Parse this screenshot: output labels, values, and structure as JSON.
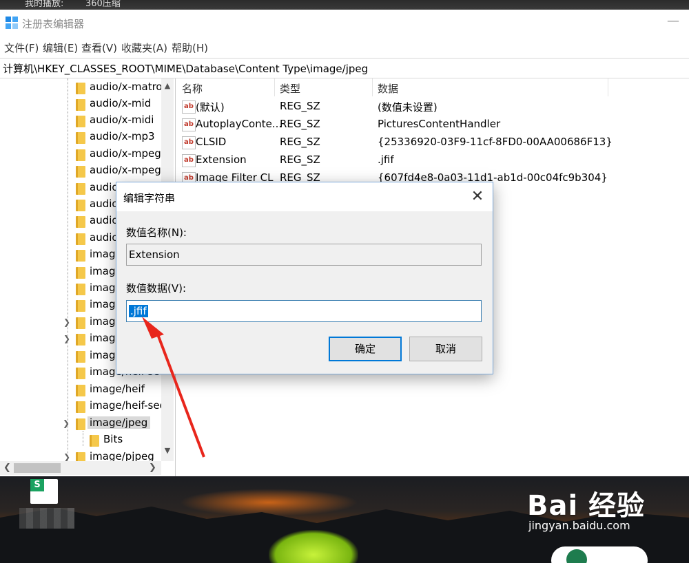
{
  "top_strip": {
    "text1": "我的播放:",
    "text2": "360压缩"
  },
  "window": {
    "title": "注册表编辑器",
    "minimize": "—"
  },
  "menu": [
    "文件(F)",
    "编辑(E)",
    "查看(V)",
    "收藏夹(A)",
    "帮助(H)"
  ],
  "address": "计算机\\HKEY_CLASSES_ROOT\\MIME\\Database\\Content Type\\image/jpeg",
  "tree": {
    "items": [
      "audio/x-matros",
      "audio/x-mid",
      "audio/x-midi",
      "audio/x-mp3",
      "audio/x-mpeg",
      "audio/x-mpegu",
      "audio",
      "audio",
      "audio",
      "audio",
      "image",
      "image",
      "image",
      "image",
      "image",
      "image",
      "image",
      "image/heif-seq",
      "image/heif",
      "image/heif-seq",
      "image/jpeg",
      "Bits",
      "image/pjpeg"
    ]
  },
  "list": {
    "headers": {
      "name": "名称",
      "type": "类型",
      "data": "数据"
    },
    "rows": [
      {
        "name": "(默认)",
        "type": "REG_SZ",
        "data": "(数值未设置)"
      },
      {
        "name": "AutoplayConte...",
        "type": "REG_SZ",
        "data": "PicturesContentHandler"
      },
      {
        "name": "CLSID",
        "type": "REG_SZ",
        "data": "{25336920-03F9-11cf-8FD0-00AA00686F13}"
      },
      {
        "name": "Extension",
        "type": "REG_SZ",
        "data": ".jfif"
      },
      {
        "name": "Image Filter CL",
        "type": "REG_SZ",
        "data": "{607fd4e8-0a03-11d1-ab1d-00c04fc9b304}"
      }
    ]
  },
  "dialog": {
    "title": "编辑字符串",
    "close": "✕",
    "name_label": "数值名称(N):",
    "name_value": "Extension",
    "data_label": "数值数据(V):",
    "data_value": ".jfif",
    "ok": "确定",
    "cancel": "取消"
  },
  "desktop": {
    "app_icon_letter": "S",
    "watermark_brand": "Bai 经验",
    "watermark_url": "jingyan.baidu.com"
  },
  "colors": {
    "selection": "#0078d7",
    "arrow": "#e8261c",
    "folder": "#f5c84a"
  }
}
